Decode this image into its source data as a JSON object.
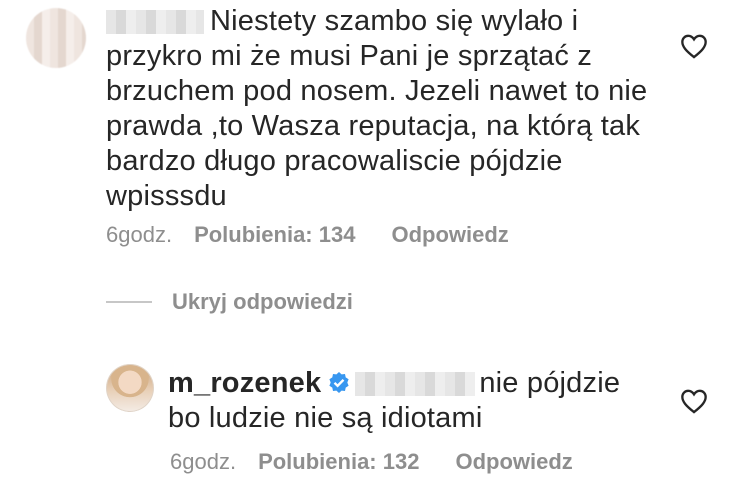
{
  "comment1": {
    "text": "Niestety szambo się wylało i przykro mi że musi Pani je sprzątać z brzuchem pod nosem.  Jezeli nawet to nie prawda ,to Wasza reputacja, na którą tak bardzo długo pracowaliscie pójdzie wpisssdu",
    "time": "6godz.",
    "likes": "Polubienia: 134",
    "reply": "Odpowiedz",
    "like_icon": "heart-outline-icon"
  },
  "hide_replies": "Ukryj odpowiedzi",
  "comment2": {
    "username": "m_rozenek",
    "verified_icon": "verified-badge-icon",
    "verified_color": "#3897f0",
    "text": "nie pójdzie bo ludzie nie są idiotami",
    "time": "6godz.",
    "likes": "Polubienia: 132",
    "reply": "Odpowiedz",
    "like_icon": "heart-outline-icon"
  }
}
